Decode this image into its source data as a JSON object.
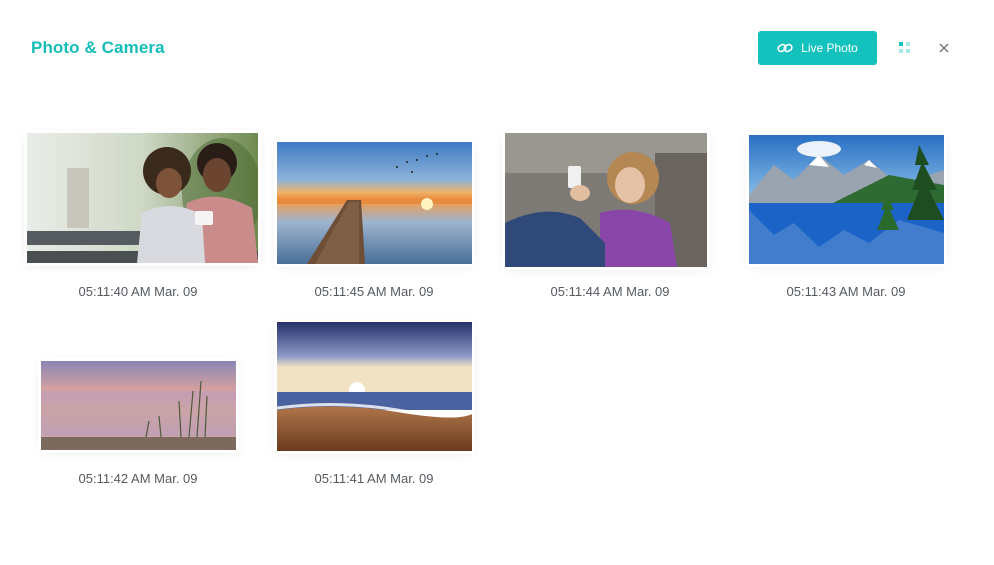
{
  "header": {
    "title": "Photo & Camera",
    "live_photo_label": "Live Photo",
    "grid_icon": "grid-icon",
    "close_icon": "close-icon",
    "link_icon": "link-icon"
  },
  "colors": {
    "accent": "#13c1bd",
    "title": "#15bdb8",
    "caption": "#555a5f"
  },
  "photos": [
    {
      "timestamp": "05:11:40 AM Mar. 09",
      "subject": "mother-and-daughter-with-phone"
    },
    {
      "timestamp": "05:11:45 AM Mar. 09",
      "subject": "wooden-pier-sunset-lake"
    },
    {
      "timestamp": "05:11:44 AM Mar. 09",
      "subject": "girl-on-couch-with-phone"
    },
    {
      "timestamp": "05:11:43 AM Mar. 09",
      "subject": "mountain-lake-reflection"
    },
    {
      "timestamp": "05:11:42 AM Mar. 09",
      "subject": "lakeside-deck-sunset"
    },
    {
      "timestamp": "05:11:41 AM Mar. 09",
      "subject": "beach-sunset-waves"
    }
  ]
}
